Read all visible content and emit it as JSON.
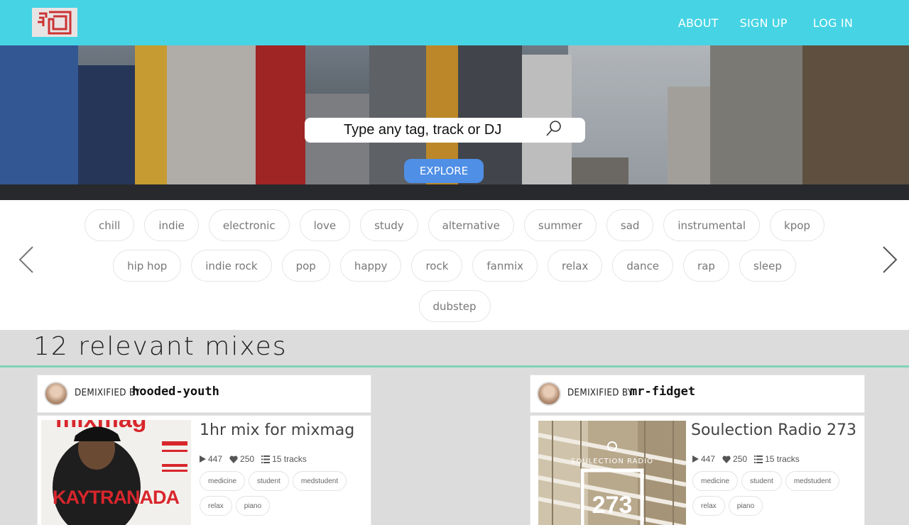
{
  "nav": {
    "logo_alt": "logo",
    "links": [
      "ABOUT",
      "SIGN UP",
      "LOG IN"
    ]
  },
  "hero": {
    "search_placeholder": "Type any tag, track or DJ",
    "explore_label": "EXPLORE"
  },
  "tags": {
    "row1": [
      "chill",
      "indie",
      "electronic",
      "love",
      "study",
      "alternative",
      "summer",
      "sad",
      "instrumental",
      "kpop"
    ],
    "row2": [
      "hip hop",
      "indie rock",
      "pop",
      "happy",
      "rock",
      "fanmix",
      "relax",
      "dance",
      "rap",
      "sleep"
    ],
    "row3": [
      "dubstep"
    ]
  },
  "mixes": {
    "heading": "12 relevant mixes",
    "cards": [
      {
        "demixified_label": "DEMIXIFIED BY",
        "dj": "hooded-youth",
        "title": "1hr mix for mixmag",
        "plays": "447",
        "likes": "250",
        "tracks": "15 tracks",
        "tags": [
          "medicine",
          "student",
          "medstudent",
          "relax",
          "piano"
        ],
        "cover_text": "KAYTRANADA",
        "cover_mag": "mixmag"
      },
      {
        "demixified_label": "DEMIXIFIED BY",
        "dj": "mr-fidget",
        "title": "Soulection Radio 273",
        "plays": "447",
        "likes": "250",
        "tracks": "15 tracks",
        "tags": [
          "medicine",
          "student",
          "medstudent",
          "relax",
          "piano"
        ],
        "cover_text": "SOULECTION RADIO",
        "cover_number": "273"
      }
    ]
  },
  "colors": {
    "nav": "#46d4e4",
    "explore": "#4f8fe6",
    "divider": "#7fd3b6",
    "logo_red": "#cc3333"
  }
}
